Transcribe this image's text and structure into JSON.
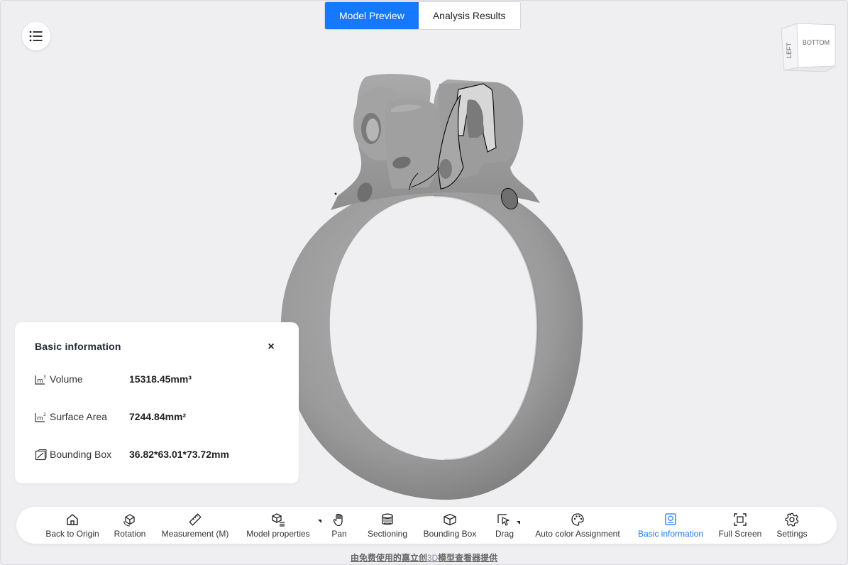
{
  "tabs": [
    {
      "label": "Model Preview",
      "active": true
    },
    {
      "label": "Analysis Results",
      "active": false
    }
  ],
  "view_cube": {
    "faces": [
      "LEFT",
      "BOTTOM"
    ]
  },
  "info_panel": {
    "title": "Basic information",
    "close_symbol": "×",
    "rows": [
      {
        "icon": "volume-icon",
        "label": "Volume",
        "value": "15318.45mm³"
      },
      {
        "icon": "surface-area-icon",
        "label": "Surface Area",
        "value": "7244.84mm²"
      },
      {
        "icon": "bounding-box-icon",
        "label": "Bounding Box",
        "value": "36.82*63.01*73.72mm"
      }
    ]
  },
  "toolbar": {
    "items": [
      {
        "label": "Back to Origin",
        "icon": "home-icon"
      },
      {
        "label": "Rotation",
        "icon": "rotation-cube-icon"
      },
      {
        "label": "Measurement (M)",
        "icon": "ruler-icon"
      },
      {
        "label": "Model properties",
        "icon": "model-properties-icon",
        "has_dropdown": true
      },
      {
        "label": "Pan",
        "icon": "hand-icon"
      },
      {
        "label": "Sectioning",
        "icon": "sectioning-icon"
      },
      {
        "label": "Bounding Box",
        "icon": "bounding-box-cube-icon"
      },
      {
        "label": "Drag",
        "icon": "drag-icon",
        "has_dropdown": true
      },
      {
        "label": "Auto color Assignment",
        "icon": "palette-icon"
      },
      {
        "label": "Basic information",
        "icon": "basic-info-icon",
        "active": true
      },
      {
        "label": "Full Screen",
        "icon": "fullscreen-icon"
      },
      {
        "label": "Settings",
        "icon": "gear-icon"
      }
    ]
  },
  "footer": {
    "prefix": "由免费使用的嘉立创",
    "highlight": "3D",
    "suffix": "模型查看器提供"
  },
  "colors": {
    "accent": "#1677ff",
    "background": "#efeff1",
    "model": "#9a9a9a"
  }
}
